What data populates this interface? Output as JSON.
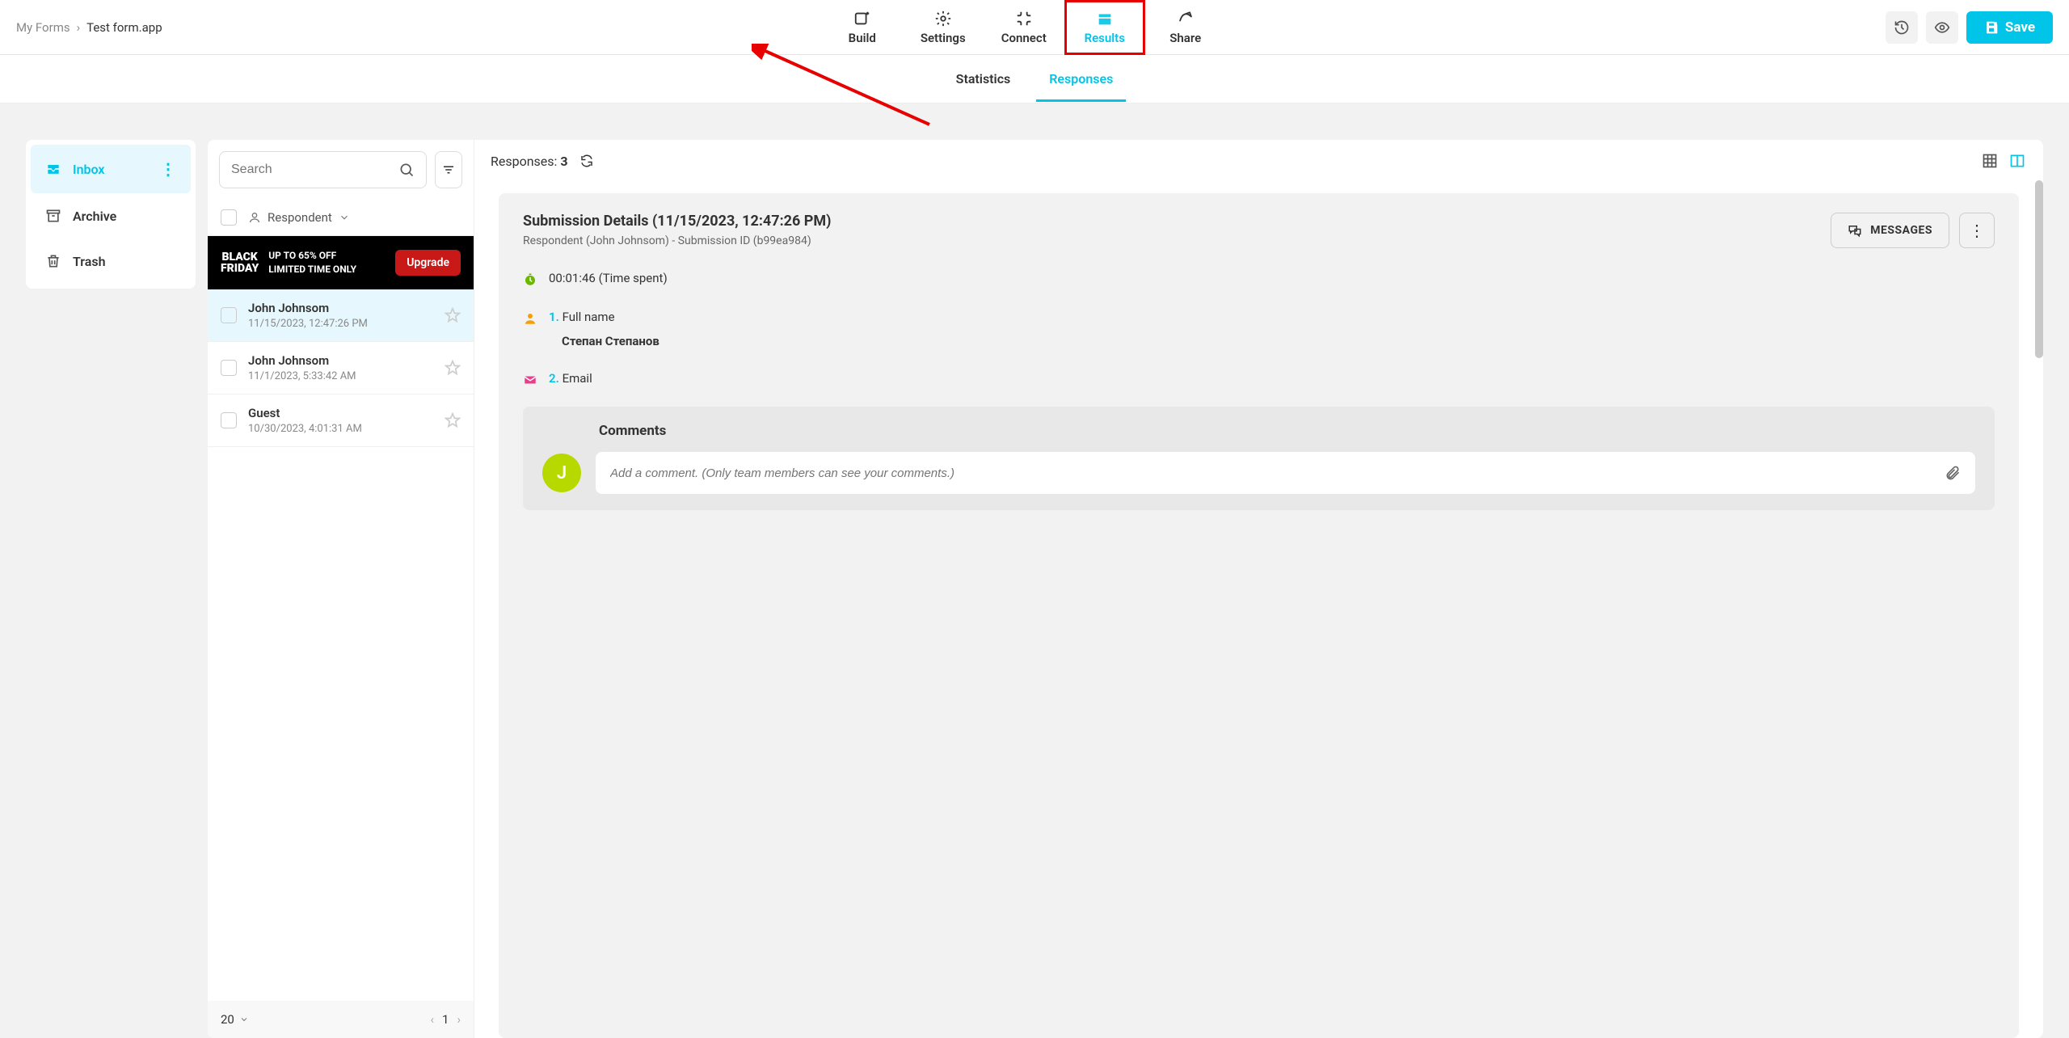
{
  "breadcrumb": {
    "root": "My Forms",
    "sep": "›",
    "current": "Test form.app"
  },
  "nav": {
    "build": "Build",
    "settings": "Settings",
    "connect": "Connect",
    "results": "Results",
    "share": "Share"
  },
  "save_btn": "Save",
  "sub_tabs": {
    "statistics": "Statistics",
    "responses": "Responses"
  },
  "sidebar": {
    "inbox": "Inbox",
    "archive": "Archive",
    "trash": "Trash"
  },
  "search_placeholder": "Search",
  "respondent_label": "Respondent",
  "promo": {
    "logo1": "BLACK",
    "logo2": "FRIDAY",
    "line1": "UP TO 65% OFF",
    "line2": "LIMITED TIME ONLY",
    "btn": "Upgrade"
  },
  "responses_label": "Responses:",
  "responses_count": "3",
  "items": [
    {
      "name": "John Johnsom",
      "date": "11/15/2023, 12:47:26 PM"
    },
    {
      "name": "John Johnsom",
      "date": "11/1/2023, 5:33:42 AM"
    },
    {
      "name": "Guest",
      "date": "10/30/2023, 4:01:31 AM"
    }
  ],
  "page_size": "20",
  "page_num": "1",
  "detail": {
    "title": "Submission Details (11/15/2023, 12:47:26 PM)",
    "subtitle": "Respondent (John Johnsom) - Submission ID (b99ea984)",
    "messages_btn": "MESSAGES",
    "time_spent": "00:01:46 (Time spent)",
    "field1_num": "1.",
    "field1_label": "Full name",
    "field1_value": "Степан Степанов",
    "field2_num": "2.",
    "field2_label": "Email",
    "comments_title": "Comments",
    "avatar_initial": "J",
    "comment_placeholder": "Add a comment. (Only team members can see your comments.)"
  }
}
